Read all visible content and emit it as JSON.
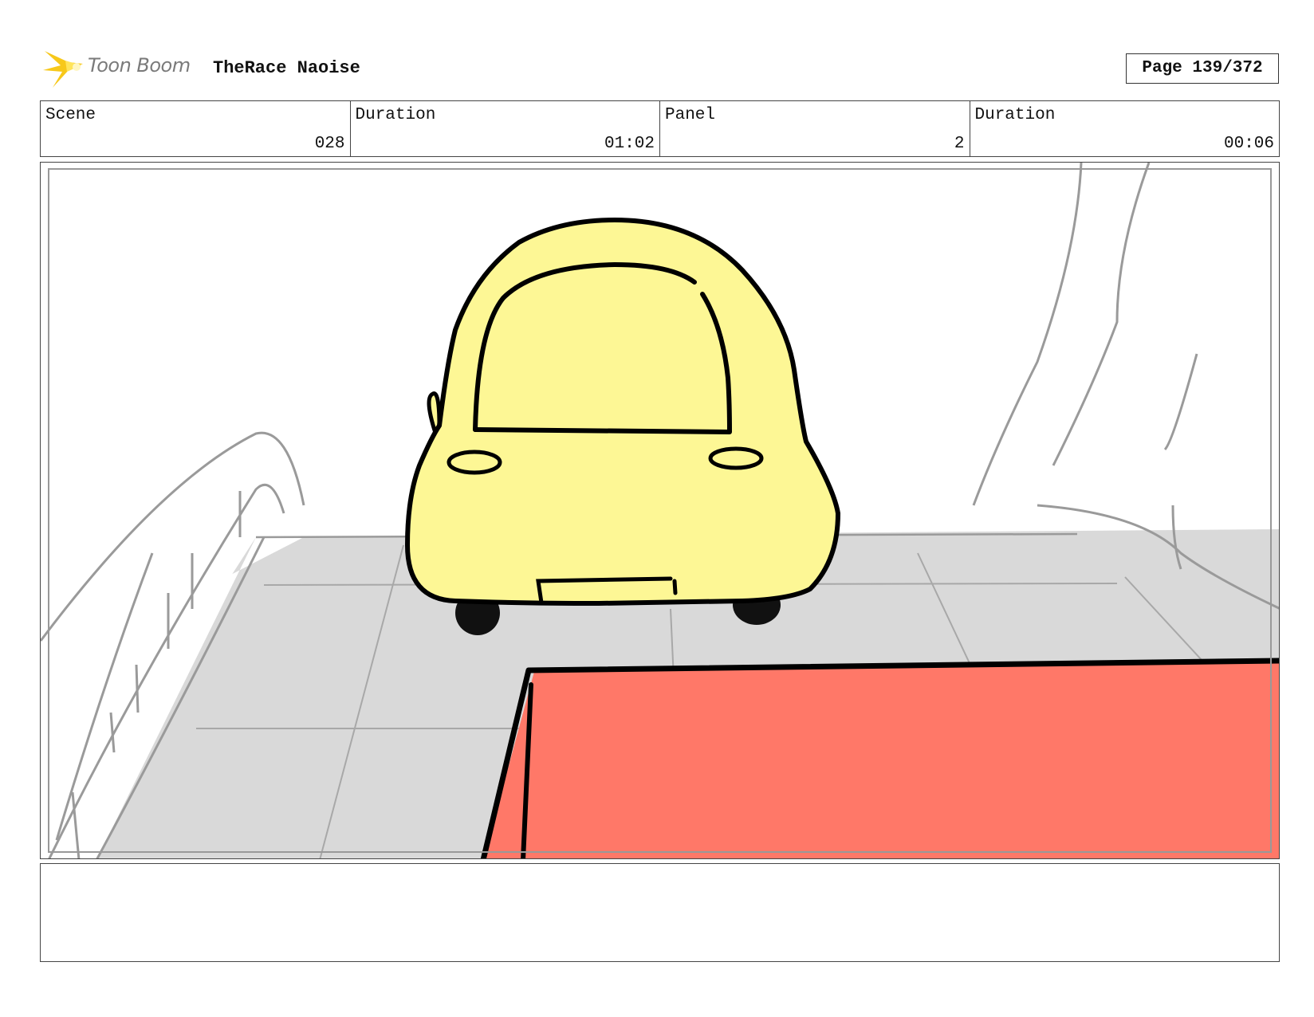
{
  "header": {
    "logo_text": "Toon Boom",
    "project_title": "TheRace Naoise",
    "page_label": "Page 139/372"
  },
  "info": [
    {
      "label": "Scene",
      "value": "028"
    },
    {
      "label": "Duration",
      "value": "01:02"
    },
    {
      "label": "Panel",
      "value": "2"
    },
    {
      "label": "Duration",
      "value": "00:06"
    }
  ],
  "notes": {
    "text": ""
  },
  "colors": {
    "car_body": "#fdf795",
    "road": "#d9d9d9",
    "red_block": "#ff7868",
    "logo_star": "#f7c81a"
  }
}
